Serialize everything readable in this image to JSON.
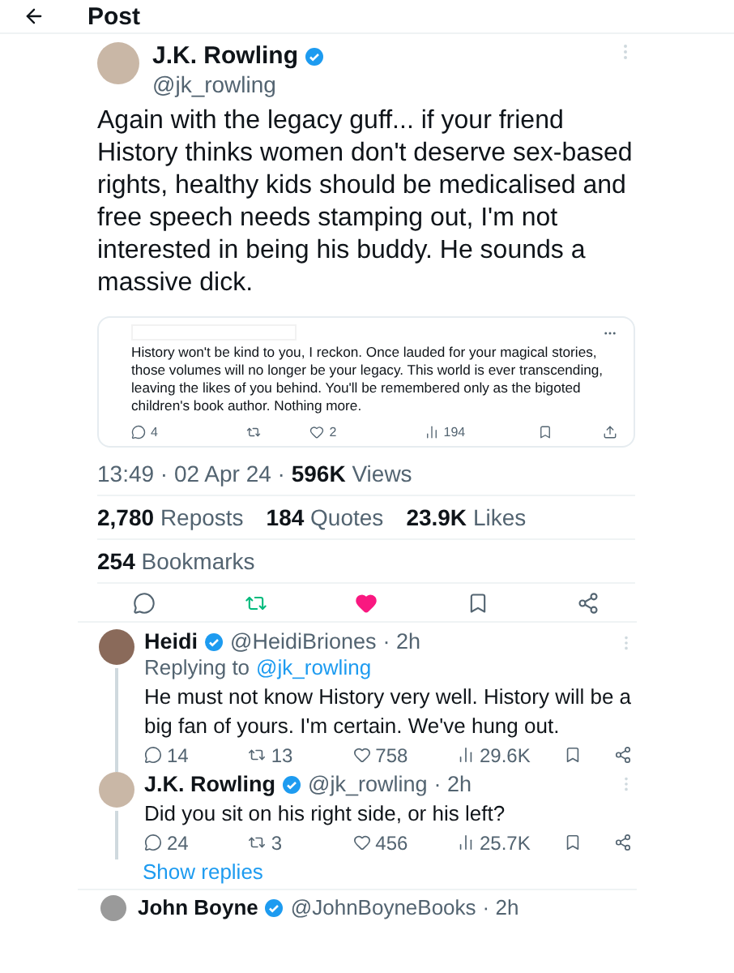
{
  "header": {
    "title": "Post"
  },
  "post": {
    "author": {
      "name": "J.K. Rowling",
      "handle": "@jk_rowling",
      "verified": true
    },
    "text": "Again with the legacy guff... if your friend History thinks women don't deserve sex-based rights, healthy kids should be medicalised and free speech needs stamping out, I'm not interested in being his buddy. He sounds a massive dick.",
    "quote": {
      "text": "History won't be kind to you, I reckon. Once lauded for your magical stories, those volumes will no longer be your legacy. This world is ever transcending, leaving the likes of you behind. You'll be remembered only as the bigoted children's book author. Nothing more.",
      "actions": [
        {
          "kind": "reply",
          "count": "4"
        },
        {
          "kind": "repost"
        },
        {
          "kind": "like",
          "count": "2"
        },
        {
          "kind": "views",
          "count": "194"
        },
        {
          "kind": "bookmark"
        },
        {
          "kind": "upload"
        }
      ]
    },
    "meta": {
      "text": "13:49 · 02 Apr 24 ·",
      "views_count": "596K",
      "views_label": "Views"
    },
    "stats": [
      {
        "count": "2,780",
        "label": "Reposts"
      },
      {
        "count": "184",
        "label": "Quotes"
      },
      {
        "count": "23.9K",
        "label": "Likes"
      }
    ],
    "bookmarks": {
      "count": "254",
      "label": "Bookmarks"
    },
    "actions": [
      {
        "kind": "reply",
        "active": false
      },
      {
        "kind": "repost",
        "active": true
      },
      {
        "kind": "like",
        "active": true
      },
      {
        "kind": "bookmark",
        "active": false
      },
      {
        "kind": "share",
        "active": false
      }
    ]
  },
  "replies": [
    {
      "name": "Heidi",
      "verified": true,
      "handle": "@HeidiBriones",
      "time": "· 2h",
      "replying_label": "Replying to",
      "replying_to": "@jk_rowling",
      "text": "He must not know History very well. History will be a big fan of yours. I'm certain. We've hung out.",
      "actions": [
        {
          "kind": "reply",
          "count": "14"
        },
        {
          "kind": "repost",
          "count": "13"
        },
        {
          "kind": "like",
          "count": "758"
        },
        {
          "kind": "views",
          "count": "29.6K"
        },
        {
          "kind": "bookmark"
        },
        {
          "kind": "share"
        }
      ]
    },
    {
      "name": "J.K. Rowling",
      "verified": true,
      "handle": "@jk_rowling",
      "time": "· 2h",
      "text": "Did you sit on his right side, or his left?",
      "actions": [
        {
          "kind": "reply",
          "count": "24"
        },
        {
          "kind": "repost",
          "count": "3"
        },
        {
          "kind": "like",
          "count": "456"
        },
        {
          "kind": "views",
          "count": "25.7K"
        },
        {
          "kind": "bookmark"
        },
        {
          "kind": "share"
        }
      ]
    }
  ],
  "show_replies": "Show replies",
  "next_reply": {
    "name": "John Boyne",
    "verified": true,
    "handle": "@JohnBoyneBooks",
    "time": "· 2h"
  }
}
